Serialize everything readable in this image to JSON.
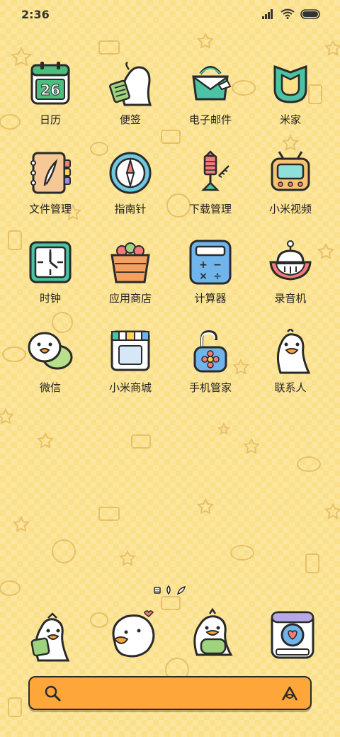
{
  "status_bar": {
    "time": "2:36"
  },
  "apps": [
    {
      "label": "日历",
      "icon": "calendar-icon",
      "date": "26"
    },
    {
      "label": "便签",
      "icon": "notes-icon"
    },
    {
      "label": "电子邮件",
      "icon": "email-icon"
    },
    {
      "label": "米家",
      "icon": "mi-home-icon"
    },
    {
      "label": "文件管理",
      "icon": "file-manager-icon"
    },
    {
      "label": "指南针",
      "icon": "compass-icon"
    },
    {
      "label": "下载管理",
      "icon": "downloads-icon"
    },
    {
      "label": "小米视频",
      "icon": "mi-video-icon"
    },
    {
      "label": "时钟",
      "icon": "clock-icon"
    },
    {
      "label": "应用商店",
      "icon": "app-store-icon"
    },
    {
      "label": "计算器",
      "icon": "calculator-icon"
    },
    {
      "label": "录音机",
      "icon": "recorder-icon"
    },
    {
      "label": "微信",
      "icon": "wechat-icon"
    },
    {
      "label": "小米商城",
      "icon": "mi-store-icon"
    },
    {
      "label": "手机管家",
      "icon": "security-icon"
    },
    {
      "label": "联系人",
      "icon": "contacts-icon"
    }
  ],
  "dock": [
    {
      "icon": "phone-duck-icon"
    },
    {
      "icon": "messages-duck-icon"
    },
    {
      "icon": "browser-duck-icon"
    },
    {
      "icon": "camera-icon"
    }
  ],
  "colors": {
    "background": "#fbe08a",
    "search_bar": "#ffa63a",
    "outline": "#2a2a2a"
  }
}
